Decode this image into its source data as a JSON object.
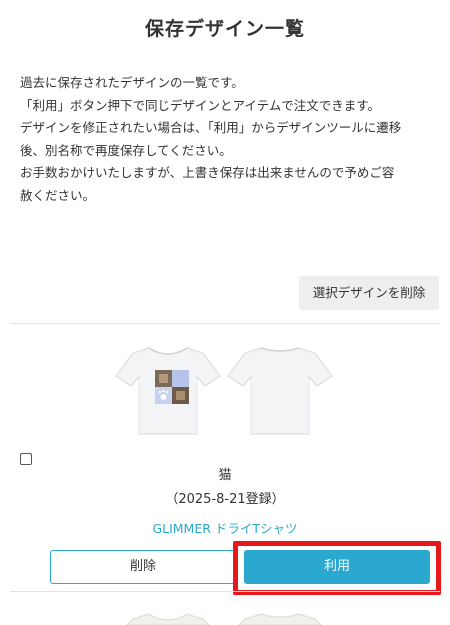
{
  "page": {
    "title": "保存デザイン一覧"
  },
  "intro": {
    "lines": [
      "過去に保存されたデザインの一覧です。",
      "「利用」ボタン押下で同じデザインとアイテムで注文できます。",
      "デザインを修正されたい場合は、「利用」からデザインツールに遷移",
      "後、別名称で再度保存してください。",
      "お手数おかけいたしますが、上書き保存は出来ませんので予めご容",
      "赦ください。"
    ]
  },
  "toolbar": {
    "delete_selected_label": "選択デザインを削除"
  },
  "designs": [
    {
      "name": "猫",
      "date": "（2025-8-21登録）",
      "product": "GLIMMER ドライTシャツ",
      "checked": false,
      "delete_label": "削除",
      "use_label": "利用"
    }
  ],
  "colors": {
    "accent": "#2aa8d0",
    "highlight": "#e8181a",
    "divider": "#e3e3e3"
  }
}
